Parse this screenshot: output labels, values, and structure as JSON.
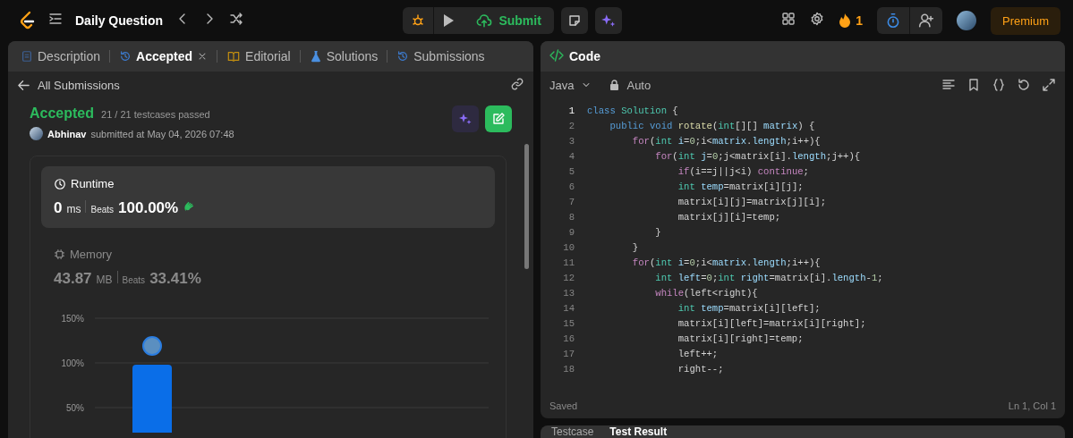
{
  "topbar": {
    "title": "Daily Question",
    "submit": "Submit",
    "streak": "1",
    "premium": "Premium"
  },
  "left_tabs": [
    {
      "label": "Description",
      "kind": "doc",
      "selected": false,
      "closable": false
    },
    {
      "label": "Accepted",
      "kind": "history",
      "selected": true,
      "closable": true
    },
    {
      "label": "Editorial",
      "kind": "book",
      "selected": false,
      "closable": false
    },
    {
      "label": "Solutions",
      "kind": "flask",
      "selected": false,
      "closable": false
    },
    {
      "label": "Submissions",
      "kind": "history",
      "selected": false,
      "closable": false
    }
  ],
  "back_link": "All Submissions",
  "submission": {
    "status": "Accepted",
    "tests": "21 / 21 testcases passed",
    "user": "Abhinav",
    "submitted": "submitted at May 04, 2026 07:48"
  },
  "stats": [
    {
      "kind": "runtime",
      "label": "Runtime",
      "value": "0",
      "unit": "ms",
      "beats_label": "Beats",
      "beats": "100.00%",
      "selected": true
    },
    {
      "kind": "memory",
      "label": "Memory",
      "value": "43.87",
      "unit": "MB",
      "beats_label": "Beats",
      "beats": "33.41%",
      "selected": false
    }
  ],
  "chart_data": {
    "type": "bar",
    "ylim": [
      0,
      150
    ],
    "yticks": [
      {
        "value": 50,
        "label": "50%"
      },
      {
        "value": 100,
        "label": "100%"
      },
      {
        "value": 150,
        "label": "150%"
      }
    ],
    "values": [
      98
    ]
  },
  "code_panel": {
    "title": "Code",
    "language": "Java",
    "mode": "Auto",
    "status": "Saved",
    "cursor": "Ln 1, Col 1"
  },
  "code_lines": [
    {
      "number": "1",
      "active": true,
      "tokens": [
        {
          "kind": "st",
          "text": "class "
        },
        {
          "kind": "ty",
          "text": "Solution"
        },
        {
          "kind": "p",
          "text": " {"
        }
      ]
    },
    {
      "number": "2",
      "active": false,
      "tokens": [
        {
          "kind": "st",
          "text": "    public void "
        },
        {
          "kind": "fn",
          "text": "rotate"
        },
        {
          "kind": "p",
          "text": "("
        },
        {
          "kind": "ty",
          "text": "int"
        },
        {
          "kind": "p",
          "text": "[][] "
        },
        {
          "kind": "var",
          "text": "matrix"
        },
        {
          "kind": "p",
          "text": ") {"
        }
      ]
    },
    {
      "number": "3",
      "active": false,
      "tokens": [
        {
          "kind": "kw",
          "text": "        for"
        },
        {
          "kind": "p",
          "text": "("
        },
        {
          "kind": "ty",
          "text": "int "
        },
        {
          "kind": "var",
          "text": "i"
        },
        {
          "kind": "p",
          "text": "="
        },
        {
          "kind": "num",
          "text": "0"
        },
        {
          "kind": "p",
          "text": ";i<"
        },
        {
          "kind": "var",
          "text": "matrix"
        },
        {
          "kind": "p",
          "text": "."
        },
        {
          "kind": "var",
          "text": "length"
        },
        {
          "kind": "p",
          "text": ";i++){"
        }
      ]
    },
    {
      "number": "4",
      "active": false,
      "tokens": [
        {
          "kind": "kw",
          "text": "            for"
        },
        {
          "kind": "p",
          "text": "("
        },
        {
          "kind": "ty",
          "text": "int "
        },
        {
          "kind": "var",
          "text": "j"
        },
        {
          "kind": "p",
          "text": "="
        },
        {
          "kind": "num",
          "text": "0"
        },
        {
          "kind": "p",
          "text": ";j<matrix[i]."
        },
        {
          "kind": "var",
          "text": "length"
        },
        {
          "kind": "p",
          "text": ";j++){"
        }
      ]
    },
    {
      "number": "5",
      "active": false,
      "tokens": [
        {
          "kind": "kw",
          "text": "                if"
        },
        {
          "kind": "p",
          "text": "(i==j||j<i) "
        },
        {
          "kind": "kw",
          "text": "continue"
        },
        {
          "kind": "p",
          "text": ";"
        }
      ]
    },
    {
      "number": "6",
      "active": false,
      "tokens": [
        {
          "kind": "ty",
          "text": "                int "
        },
        {
          "kind": "var",
          "text": "temp"
        },
        {
          "kind": "p",
          "text": "=matrix[i][j];"
        }
      ]
    },
    {
      "number": "7",
      "active": false,
      "tokens": [
        {
          "kind": "p",
          "text": "                matrix[i][j]=matrix[j][i];"
        }
      ]
    },
    {
      "number": "8",
      "active": false,
      "tokens": [
        {
          "kind": "p",
          "text": "                matrix[j][i]=temp;"
        }
      ]
    },
    {
      "number": "9",
      "active": false,
      "tokens": [
        {
          "kind": "p",
          "text": "            }"
        }
      ]
    },
    {
      "number": "10",
      "active": false,
      "tokens": [
        {
          "kind": "p",
          "text": "        }"
        }
      ]
    },
    {
      "number": "11",
      "active": false,
      "tokens": [
        {
          "kind": "kw",
          "text": "        for"
        },
        {
          "kind": "p",
          "text": "("
        },
        {
          "kind": "ty",
          "text": "int "
        },
        {
          "kind": "var",
          "text": "i"
        },
        {
          "kind": "p",
          "text": "="
        },
        {
          "kind": "num",
          "text": "0"
        },
        {
          "kind": "p",
          "text": ";i<"
        },
        {
          "kind": "var",
          "text": "matrix"
        },
        {
          "kind": "p",
          "text": "."
        },
        {
          "kind": "var",
          "text": "length"
        },
        {
          "kind": "p",
          "text": ";i++){"
        }
      ]
    },
    {
      "number": "12",
      "active": false,
      "tokens": [
        {
          "kind": "ty",
          "text": "            int "
        },
        {
          "kind": "var",
          "text": "left"
        },
        {
          "kind": "p",
          "text": "="
        },
        {
          "kind": "num",
          "text": "0"
        },
        {
          "kind": "p",
          "text": ";"
        },
        {
          "kind": "ty",
          "text": "int "
        },
        {
          "kind": "var",
          "text": "right"
        },
        {
          "kind": "p",
          "text": "=matrix[i]."
        },
        {
          "kind": "var",
          "text": "length"
        },
        {
          "kind": "p",
          "text": "-"
        },
        {
          "kind": "num",
          "text": "1"
        },
        {
          "kind": "p",
          "text": ";"
        }
      ]
    },
    {
      "number": "13",
      "active": false,
      "tokens": [
        {
          "kind": "kw",
          "text": "            while"
        },
        {
          "kind": "p",
          "text": "(left<right){"
        }
      ]
    },
    {
      "number": "14",
      "active": false,
      "tokens": [
        {
          "kind": "ty",
          "text": "                int "
        },
        {
          "kind": "var",
          "text": "temp"
        },
        {
          "kind": "p",
          "text": "=matrix[i][left];"
        }
      ]
    },
    {
      "number": "15",
      "active": false,
      "tokens": [
        {
          "kind": "p",
          "text": "                matrix[i][left]=matrix[i][right];"
        }
      ]
    },
    {
      "number": "16",
      "active": false,
      "tokens": [
        {
          "kind": "p",
          "text": "                matrix[i][right]=temp;"
        }
      ]
    },
    {
      "number": "17",
      "active": false,
      "tokens": [
        {
          "kind": "p",
          "text": "                left++;"
        }
      ]
    },
    {
      "number": "18",
      "active": false,
      "tokens": [
        {
          "kind": "p",
          "text": "                right--;"
        }
      ]
    }
  ],
  "bottom_tabs": [
    {
      "label": "Testcase",
      "selected": false
    },
    {
      "label": "Test Result",
      "selected": true
    }
  ]
}
